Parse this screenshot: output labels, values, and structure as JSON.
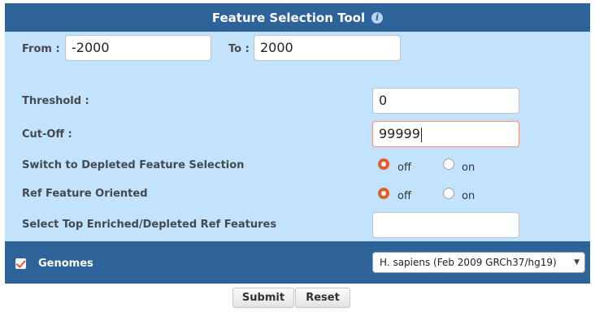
{
  "header": {
    "title": "Feature Selection Tool",
    "info_icon": "i"
  },
  "range": {
    "from_label": "From :",
    "from_value": "-2000",
    "to_label": "To :",
    "to_value": "2000"
  },
  "threshold": {
    "label": "Threshold :",
    "value": "0"
  },
  "cutoff": {
    "label": "Cut-Off :",
    "value": "99999"
  },
  "depleted": {
    "label": "Switch to Depleted Feature Selection",
    "options": [
      "off",
      "on"
    ],
    "selected": "off"
  },
  "ref_oriented": {
    "label": "Ref Feature Oriented",
    "options": [
      "off",
      "on"
    ],
    "selected": "off"
  },
  "top_features": {
    "label": "Select Top Enriched/Depleted Ref Features",
    "value": ""
  },
  "genomes": {
    "label": "Genomes",
    "checked": true,
    "selected": "H. sapiens (Feb 2009 GRCh37/hg19)",
    "arrow": "▼"
  },
  "buttons": {
    "submit": "Submit",
    "reset": "Reset"
  },
  "colors": {
    "header": "#2e6399",
    "panel": "#c3e2fb",
    "accent": "#e0602c"
  }
}
